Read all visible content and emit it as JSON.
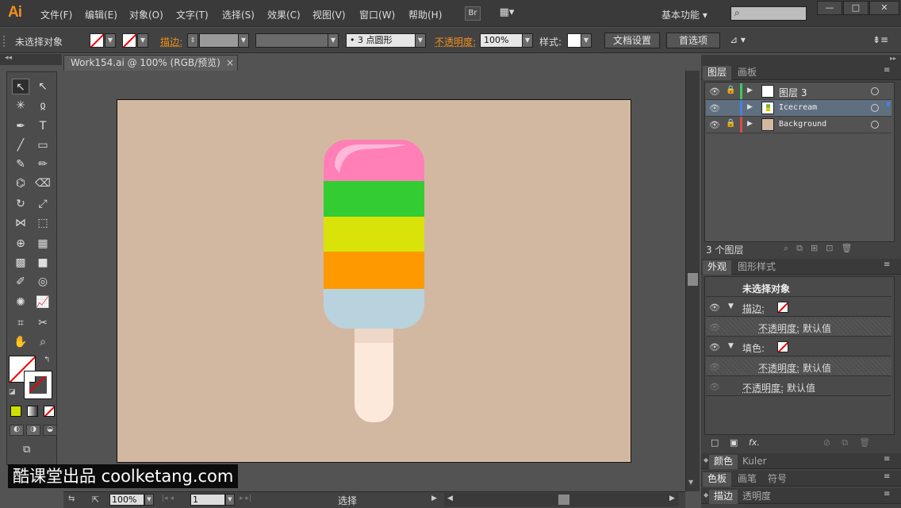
{
  "app": {
    "logo": "Ai",
    "workspace": "基本功能 ▾"
  },
  "menu": [
    "文件(F)",
    "编辑(E)",
    "对象(O)",
    "文字(T)",
    "选择(S)",
    "效果(C)",
    "视图(V)",
    "窗口(W)",
    "帮助(H)"
  ],
  "menu_buttons": {
    "bridge": "Br",
    "arrange": "▦▾"
  },
  "window_buttons": {
    "minimize": "—",
    "maximize": "□",
    "close": "✕"
  },
  "control": {
    "selection_label": "未选择对象",
    "stroke_label": "描边:",
    "brush_value": "• 3 点圆形",
    "opacity_label": "不透明度:",
    "opacity_value": "100%",
    "style_label": "样式:",
    "doc_settings": "文档设置",
    "preferences": "首选项"
  },
  "document": {
    "tab_title": "Work154.ai @ 100% (RGB/预览)",
    "close": "×"
  },
  "status": {
    "zoom": "100%",
    "page": "1",
    "tool": "选择"
  },
  "layers_panel": {
    "tabs": [
      "图层",
      "画板"
    ],
    "layers": [
      {
        "name": "图层 3",
        "color": "#39c95a",
        "locked": true,
        "selected": false
      },
      {
        "name": "Icecream",
        "color": "#4a7fe0",
        "locked": false,
        "selected": true
      },
      {
        "name": "Background",
        "color": "#e04848",
        "locked": true,
        "selected": false
      }
    ],
    "count": "3 个图层"
  },
  "appearance_panel": {
    "tabs": [
      "外观",
      "图形样式"
    ],
    "title": "未选择对象",
    "stroke_label": "描边:",
    "fill_label": "填色:",
    "opacity_label": "不透明度:",
    "default_value": "默认值",
    "fx": "fx."
  },
  "collapsed_panels": [
    {
      "tabs": [
        "颜色",
        "Kuler"
      ]
    },
    {
      "tabs": [
        "色板",
        "画笔",
        "符号"
      ]
    },
    {
      "tabs": [
        "描边",
        "透明度"
      ]
    }
  ],
  "icecream": {
    "bands": [
      {
        "name": "pink",
        "color": "#ff7fb6"
      },
      {
        "name": "green",
        "color": "#33cc33"
      },
      {
        "name": "yellow",
        "color": "#d9e30a"
      },
      {
        "name": "orange",
        "color": "#ff9900"
      },
      {
        "name": "blue",
        "color": "#b9d3de"
      }
    ],
    "stick_color": "#fde9dc",
    "stick_shadow": "#eed7c6"
  },
  "artboard_color": "#d3b8a1",
  "watermark": "酷课堂出品 coolketang.com"
}
